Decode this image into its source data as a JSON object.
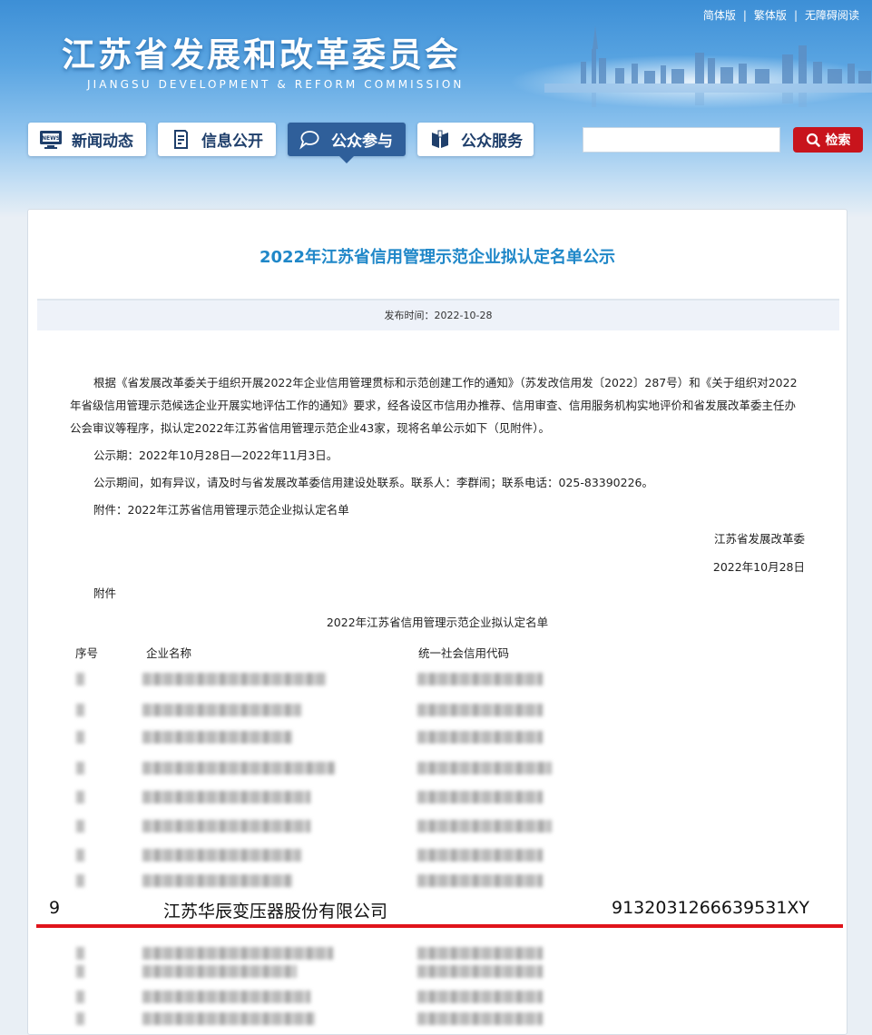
{
  "header": {
    "top_links": [
      "简体版",
      "繁体版",
      "无障碍阅读"
    ],
    "site_title": "江苏省发展和改革委员会",
    "site_subtitle": "JIANGSU DEVELOPMENT & REFORM COMMISSION",
    "nav": [
      {
        "label": "新闻动态",
        "icon": "news-icon"
      },
      {
        "label": "信息公开",
        "icon": "document-icon"
      },
      {
        "label": "公众参与",
        "icon": "chat-icon",
        "active": true
      },
      {
        "label": "公众服务",
        "icon": "book-icon"
      }
    ],
    "search": {
      "placeholder": "",
      "button_label": "检索"
    }
  },
  "article": {
    "title": "2022年江苏省信用管理示范企业拟认定名单公示",
    "publish_time": "发布时间：2022-10-28",
    "paragraphs": [
      "根据《省发展改革委关于组织开展2022年企业信用管理贯标和示范创建工作的通知》（苏发改信用发〔2022〕287号）和《关于组织对2022年省级信用管理示范候选企业开展实地评估工作的通知》要求，经各设区市信用办推荐、信用审查、信用服务机构实地评价和省发展改革委主任办公会审议等程序，拟认定2022年江苏省信用管理示范企业43家，现将名单公示如下（见附件）。",
      "公示期：2022年10月28日—2022年11月3日。",
      "公示期间，如有异议，请及时与省发展改革委信用建设处联系。联系人：李群闹；联系电话：025-83390226。",
      "附件：2022年江苏省信用管理示范企业拟认定名单"
    ],
    "signature": "江苏省发展改革委",
    "sign_date": "2022年10月28日",
    "attachment_label": "附件",
    "table_title": "2022年江苏省信用管理示范企业拟认定名单",
    "table_headers": [
      "序号",
      "企业名称",
      "统一社会信用代码"
    ],
    "highlight_row": {
      "index": "9",
      "name": "江苏华辰变压器股份有限公司",
      "code": "913203126663953​1XY"
    }
  },
  "colors": {
    "accent_blue": "#1f87c8",
    "nav_active": "#2f5f9a",
    "search_button": "#c8141c",
    "highlight_line": "#e0141b"
  }
}
